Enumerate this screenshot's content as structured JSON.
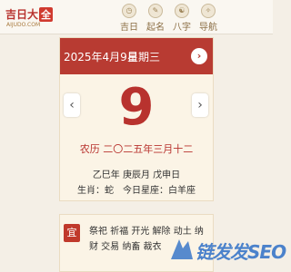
{
  "brand": {
    "name": "吉日大",
    "mark": "全",
    "domain": "AIJUDO.COM"
  },
  "nav": [
    {
      "label": "吉日",
      "icon": "calendar-icon"
    },
    {
      "label": "起名",
      "icon": "name-icon"
    },
    {
      "label": "八字",
      "icon": "bazi-icon"
    },
    {
      "label": "导航",
      "icon": "compass-icon"
    }
  ],
  "calendar": {
    "date": "2025年4月9日",
    "weekday": "星期三",
    "day": "9",
    "lunar": "农历 二〇二五年三月十二",
    "ganzhi": "乙巳年 庚辰月 戊申日",
    "zodiac": "生肖：蛇　今日星座：白羊座"
  },
  "yi": {
    "badge": "宜",
    "text": "祭祀 祈福 开光 解除 动土 纳财 交易 纳畜 裁衣"
  },
  "watermark": {
    "text": "链发发SEO"
  },
  "colors": {
    "accent": "#b83b32",
    "background": "#f4efe6",
    "card": "#fbf4e6"
  }
}
